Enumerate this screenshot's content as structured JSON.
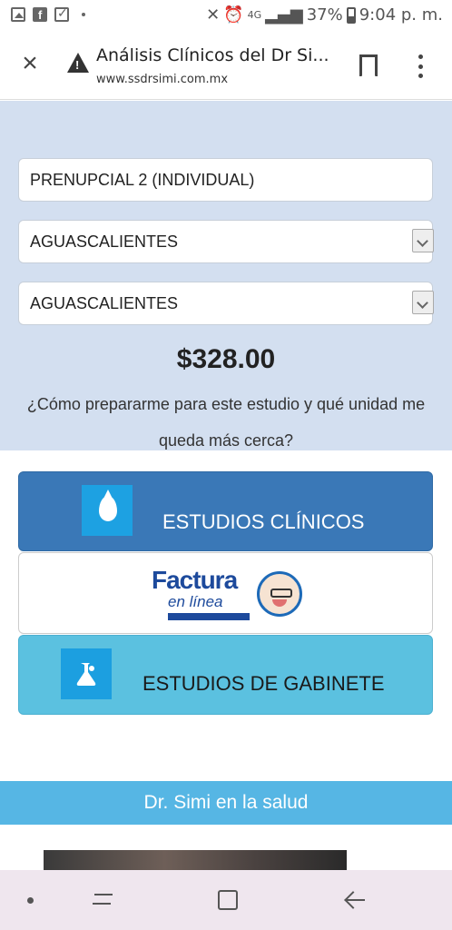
{
  "status_bar": {
    "network": "4G",
    "battery": "37%",
    "time": "9:04 p. m."
  },
  "browser": {
    "title": "Análisis Clínicos del Dr Si...",
    "url": "www.ssdrsimi.com.mx"
  },
  "form": {
    "study_value": "PRENUPCIAL 2 (INDIVIDUAL)",
    "state_value": "AGUASCALIENTES",
    "city_value": "AGUASCALIENTES",
    "price": "$328.00",
    "prep_link": "¿Cómo prepararme para este estudio y qué unidad me queda más cerca?"
  },
  "buttons": {
    "clinicos_label": "ESTUDIOS CLÍNICOS",
    "factura_word": "Factura",
    "factura_sub": "en línea",
    "gabinete_label": "ESTUDIOS DE GABINETE"
  },
  "banner": {
    "title": "Dr. Simi en la salud"
  },
  "colors": {
    "form_bg": "#d3dff0",
    "btn_clinicos": "#3a78b7",
    "btn_gabinete": "#5bc1e0",
    "banner": "#56b6e4",
    "icon_blue": "#1da1e2"
  },
  "icons": [
    "image-icon",
    "facebook-icon",
    "checklist-icon",
    "warning-icon",
    "close-icon",
    "bookmark-icon",
    "more-vert-icon",
    "water-drop-icon",
    "flask-icon",
    "dr-simi-logo-icon",
    "recent-apps-icon",
    "home-icon",
    "back-icon"
  ]
}
